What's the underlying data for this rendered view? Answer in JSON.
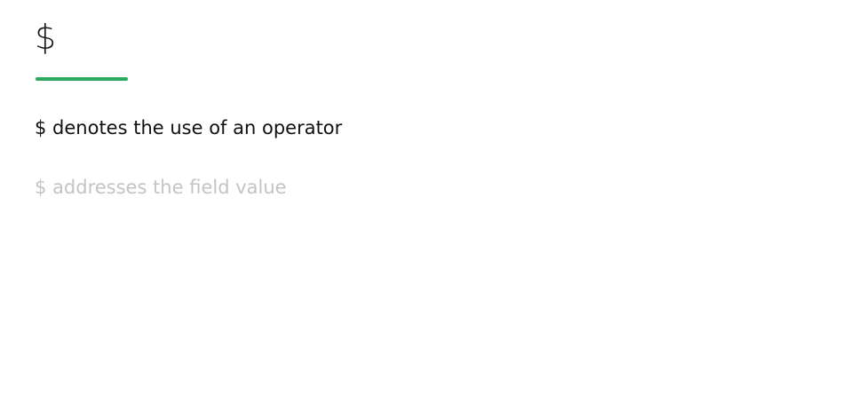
{
  "card": {
    "term": "$",
    "accent_color": "#2daa5f",
    "definitions": [
      {
        "text": "$ denotes the use of an operator",
        "state": "active"
      },
      {
        "text": "$ addresses the field value",
        "state": "muted"
      }
    ]
  }
}
